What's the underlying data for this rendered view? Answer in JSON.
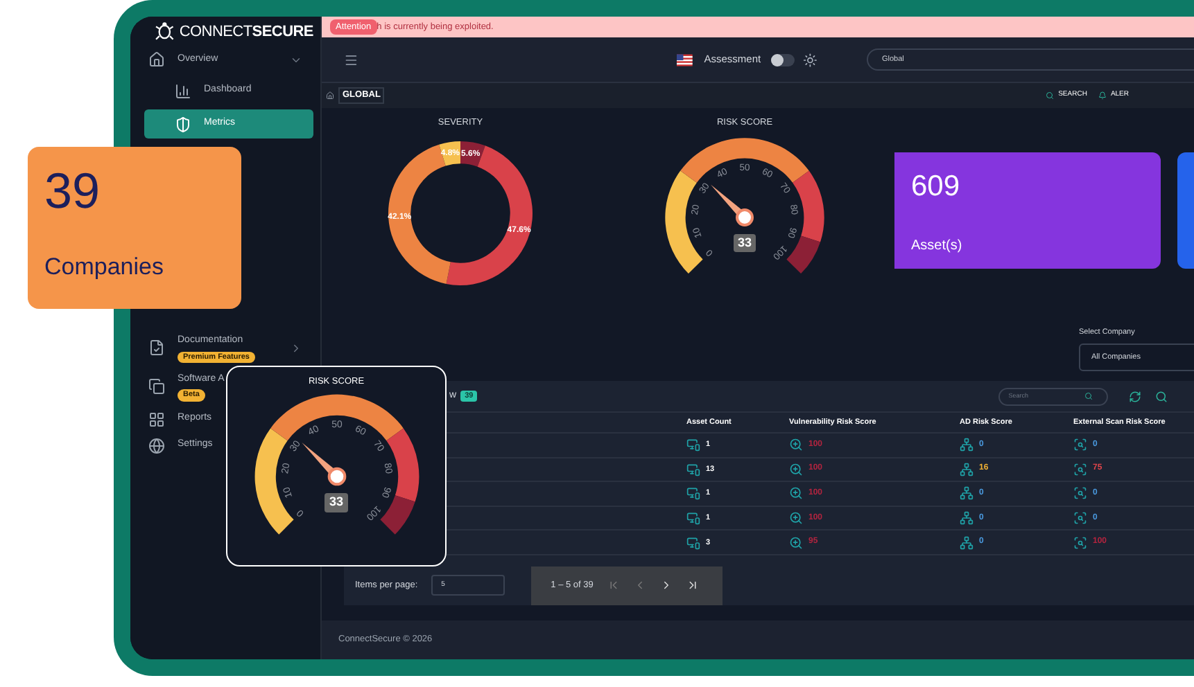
{
  "companies_card": {
    "count": "39",
    "label": "Companies"
  },
  "sidebar": {
    "logo": {
      "light": "CONNECT",
      "bold": "SECURE"
    },
    "items": [
      {
        "label": "Overview",
        "expanded": true,
        "selected": false,
        "children": [
          {
            "label": "Dashboard",
            "selected": false
          },
          {
            "label": "Metrics",
            "selected": true
          }
        ]
      },
      {
        "label": "Documentation",
        "badge": "Premium Features",
        "expandable": true,
        "selected": false
      },
      {
        "label": "Software A",
        "badge": "Beta",
        "selected": false
      },
      {
        "label": "Reports",
        "selected": false
      },
      {
        "label": "Settings",
        "selected": false
      }
    ]
  },
  "banner": {
    "tag": "Attention",
    "message": "h is currently being exploited."
  },
  "header": {
    "mode_label": "Assessment",
    "mode_on": false,
    "search_value": "Global"
  },
  "breadcrumb": {
    "label": "GLOBAL",
    "actions": [
      "SEARCH",
      "ALER"
    ]
  },
  "severity": {
    "chart_data": {
      "type": "donut",
      "title": "SEVERITY",
      "values": [
        5.6,
        47.6,
        42.1,
        4.8
      ],
      "colors": [
        "#8c2036",
        "#d9424a",
        "#ed8443",
        "#f6c04f"
      ],
      "value_labels": [
        "5.6%",
        "47.6%",
        "42.1%",
        "4.8%"
      ]
    }
  },
  "risk_gauge": {
    "title": "RISK SCORE",
    "level": 0.33,
    "reading": "33",
    "ticks": [
      "0",
      "10",
      "20",
      "30",
      "40",
      "50",
      "60",
      "70",
      "80",
      "90",
      "100"
    ]
  },
  "asset_card": {
    "value": "609",
    "label": "Asset(s)"
  },
  "company_select": {
    "label": "Select Company",
    "value": "All Companies"
  },
  "table": {
    "title": "w",
    "count": "39",
    "search_placeholder": "Search",
    "columns": [
      "",
      "Asset Count",
      "Vulnerability Risk Score",
      "AD Risk Score",
      "External Scan Risk Score"
    ],
    "rows": [
      {
        "assets": "1",
        "vuln": {
          "value": "100",
          "color": "#b3243f"
        },
        "ad": {
          "value": "0",
          "color": "#4a9ae0"
        },
        "ext": {
          "value": "0",
          "color": "#4a9ae0"
        }
      },
      {
        "assets": "13",
        "vuln": {
          "value": "100",
          "color": "#b3243f"
        },
        "ad": {
          "value": "16",
          "color": "#f2b233"
        },
        "ext": {
          "value": "75",
          "color": "#e2454b"
        }
      },
      {
        "assets": "1",
        "vuln": {
          "value": "100",
          "color": "#b3243f"
        },
        "ad": {
          "value": "0",
          "color": "#4a9ae0"
        },
        "ext": {
          "value": "0",
          "color": "#4a9ae0"
        }
      },
      {
        "assets": "1",
        "vuln": {
          "value": "100",
          "color": "#b3243f"
        },
        "ad": {
          "value": "0",
          "color": "#4a9ae0"
        },
        "ext": {
          "value": "0",
          "color": "#4a9ae0"
        }
      },
      {
        "assets": "3",
        "vuln": {
          "value": "95",
          "color": "#b3243f"
        },
        "ad": {
          "value": "0",
          "color": "#4a9ae0"
        },
        "ext": {
          "value": "100",
          "color": "#b3243f"
        }
      }
    ]
  },
  "paginator": {
    "label": "Items per page:",
    "page_size": "5",
    "range": "1 – 5 of 39"
  },
  "footer": "ConnectSecure © 2026",
  "popup_gauge": {
    "title": "RISK SCORE",
    "level": 0.33,
    "reading": "33",
    "ticks": [
      "0",
      "10",
      "20",
      "30",
      "40",
      "50",
      "60",
      "70",
      "80",
      "90",
      "100"
    ]
  }
}
